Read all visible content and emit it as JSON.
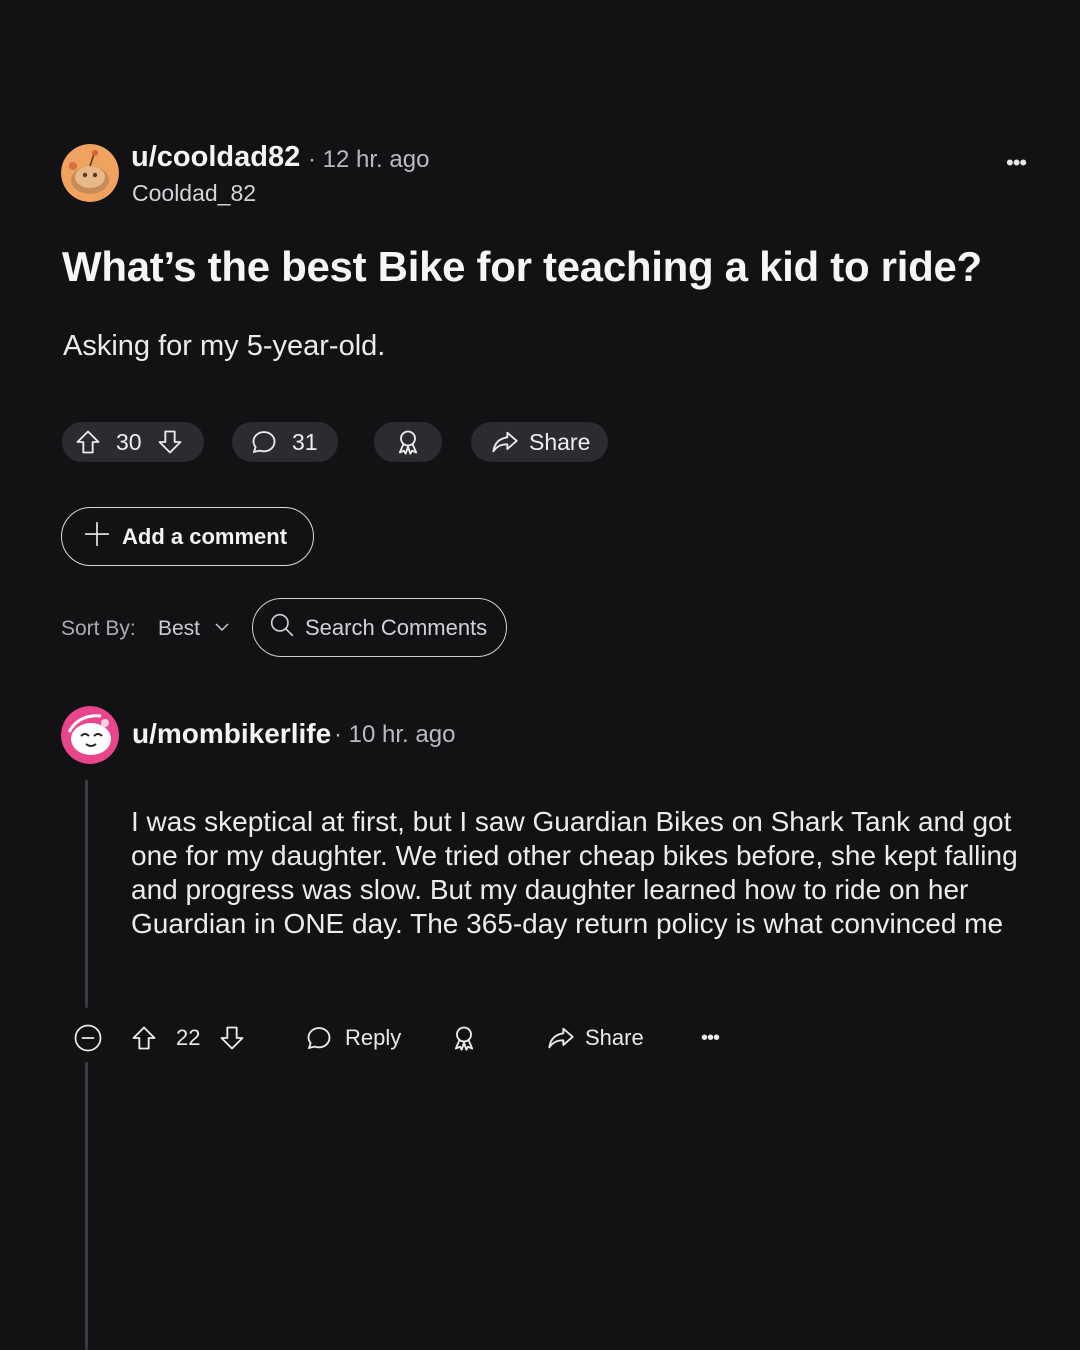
{
  "post": {
    "author": "u/cooldad82",
    "separator": "·",
    "time": "12 hr. ago",
    "handle": "Cooldad_82",
    "more": "•••",
    "title": "What’s the best Bike for teaching a kid to ride?",
    "body": "Asking for my 5-year-old.",
    "votes": "30",
    "comments_count": "31",
    "share_label": "Share",
    "avatar_color": "#f0a35e"
  },
  "add_comment_label": "Add a comment",
  "sort": {
    "label": "Sort By:",
    "value": "Best"
  },
  "search": {
    "placeholder": "Search Comments"
  },
  "comment": {
    "author": "u/mombikerlife",
    "separator": "·",
    "time": "10 hr. ago",
    "body": "I was skeptical at first, but I saw Guardian Bikes on Shark Tank and got one for my daughter. We tried other cheap bikes before, she kept falling and progress was slow. But my daughter learned how to ride on her Guardian in ONE day. The 365-day return policy is what convinced me",
    "votes": "22",
    "reply_label": "Reply",
    "share_label": "Share",
    "more": "•••",
    "avatar_color": "#e8458c"
  },
  "colors": {
    "background": "#121214",
    "pill": "#2a2c30",
    "muted": "#b8bcc0"
  }
}
